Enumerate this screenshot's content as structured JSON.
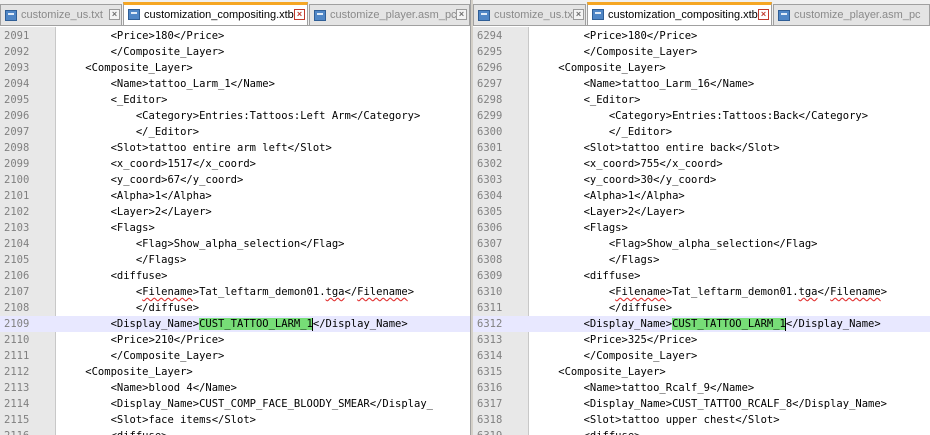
{
  "panes": [
    {
      "tabs": [
        {
          "label": "customize_us.txt",
          "active": false
        },
        {
          "label": "customization_compositing.xtbl",
          "active": true
        },
        {
          "label": "customize_player.asm_pc",
          "active": false
        }
      ],
      "lines": [
        {
          "n": "2091",
          "t": "        <Price>180</Price>"
        },
        {
          "n": "2092",
          "t": "        </Composite_Layer>"
        },
        {
          "n": "2093",
          "t": "    <Composite_Layer>"
        },
        {
          "n": "2094",
          "t": "        <Name>tattoo_Larm_1</Name>"
        },
        {
          "n": "2095",
          "t": "        <_Editor>"
        },
        {
          "n": "2096",
          "t": "            <Category>Entries:Tattoos:Left Arm</Category>"
        },
        {
          "n": "2097",
          "t": "            </_Editor>"
        },
        {
          "n": "2098",
          "t": "        <Slot>tattoo entire arm left</Slot>"
        },
        {
          "n": "2099",
          "t": "        <x_coord>1517</x_coord>"
        },
        {
          "n": "2100",
          "t": "        <y_coord>67</y_coord>"
        },
        {
          "n": "2101",
          "t": "        <Alpha>1</Alpha>"
        },
        {
          "n": "2102",
          "t": "        <Layer>2</Layer>"
        },
        {
          "n": "2103",
          "t": "        <Flags>"
        },
        {
          "n": "2104",
          "t": "            <Flag>Show_alpha_selection</Flag>"
        },
        {
          "n": "2105",
          "t": "            </Flags>"
        },
        {
          "n": "2106",
          "t": "        <diffuse>"
        },
        {
          "n": "2107",
          "t": "            <Filename>Tat_leftarm_demon01.tga</Filename>"
        },
        {
          "n": "2108",
          "t": "            </diffuse>"
        },
        {
          "n": "2109",
          "t": "        <Display_Name>CUST_TATTOO_LARM_1</Display_Name>"
        },
        {
          "n": "2110",
          "t": "        <Price>210</Price>"
        },
        {
          "n": "2111",
          "t": "        </Composite_Layer>"
        },
        {
          "n": "2112",
          "t": "    <Composite_Layer>"
        },
        {
          "n": "2113",
          "t": "        <Name>blood 4</Name>"
        },
        {
          "n": "2114",
          "t": "        <Display_Name>CUST_COMP_FACE_BLOODY_SMEAR</Display_"
        },
        {
          "n": "2115",
          "t": "        <Slot>face items</Slot>"
        },
        {
          "n": "2116",
          "t": "        <diffuse>"
        }
      ],
      "current_line": 18,
      "highlight": {
        "line": 18,
        "text": "CUST_TATTOO_LARM_1"
      },
      "squiggles": [
        {
          "line": 16,
          "text": "Filename"
        },
        {
          "line": 16,
          "text": "tga"
        }
      ]
    },
    {
      "tabs": [
        {
          "label": "customize_us.txt",
          "active": false
        },
        {
          "label": "customization_compositing.xtbl",
          "active": true
        },
        {
          "label": "customize_player.asm_pc",
          "active": false
        }
      ],
      "lines": [
        {
          "n": "6294",
          "t": "        <Price>180</Price>"
        },
        {
          "n": "6295",
          "t": "        </Composite_Layer>"
        },
        {
          "n": "6296",
          "t": "    <Composite_Layer>"
        },
        {
          "n": "6297",
          "t": "        <Name>tattoo_Larm_16</Name>"
        },
        {
          "n": "6298",
          "t": "        <_Editor>"
        },
        {
          "n": "6299",
          "t": "            <Category>Entries:Tattoos:Back</Category>"
        },
        {
          "n": "6300",
          "t": "            </_Editor>"
        },
        {
          "n": "6301",
          "t": "        <Slot>tattoo entire back</Slot>"
        },
        {
          "n": "6302",
          "t": "        <x_coord>755</x_coord>"
        },
        {
          "n": "6303",
          "t": "        <y_coord>30</y_coord>"
        },
        {
          "n": "6304",
          "t": "        <Alpha>1</Alpha>"
        },
        {
          "n": "6305",
          "t": "        <Layer>2</Layer>"
        },
        {
          "n": "6306",
          "t": "        <Flags>"
        },
        {
          "n": "6307",
          "t": "            <Flag>Show_alpha_selection</Flag>"
        },
        {
          "n": "6308",
          "t": "            </Flags>"
        },
        {
          "n": "6309",
          "t": "        <diffuse>"
        },
        {
          "n": "6310",
          "t": "            <Filename>Tat_leftarm_demon01.tga</Filename>"
        },
        {
          "n": "6311",
          "t": "            </diffuse>"
        },
        {
          "n": "6312",
          "t": "        <Display_Name>CUST_TATTOO_LARM_1</Display_Name>"
        },
        {
          "n": "6313",
          "t": "        <Price>325</Price>"
        },
        {
          "n": "6314",
          "t": "        </Composite_Layer>"
        },
        {
          "n": "6315",
          "t": "    <Composite_Layer>"
        },
        {
          "n": "6316",
          "t": "        <Name>tattoo_Rcalf_9</Name>"
        },
        {
          "n": "6317",
          "t": "        <Display_Name>CUST_TATTOO_RCALF_8</Display_Name>"
        },
        {
          "n": "6318",
          "t": "        <Slot>tattoo upper chest</Slot>"
        },
        {
          "n": "6319",
          "t": "        <diffuse>"
        }
      ],
      "current_line": 18,
      "highlight": {
        "line": 18,
        "text": "CUST_TATTOO_LARM_1"
      },
      "squiggles": [
        {
          "line": 16,
          "text": "Filename"
        },
        {
          "line": 16,
          "text": "tga"
        }
      ]
    }
  ],
  "colors": {
    "highlight": "#77dd77",
    "current_line": "#e8e8ff",
    "active_tab_accent": "#f5a623",
    "gutter": "#e8e8e8"
  },
  "icons": {
    "file_tab": "xml-file-icon",
    "close_tab": "close-icon"
  }
}
